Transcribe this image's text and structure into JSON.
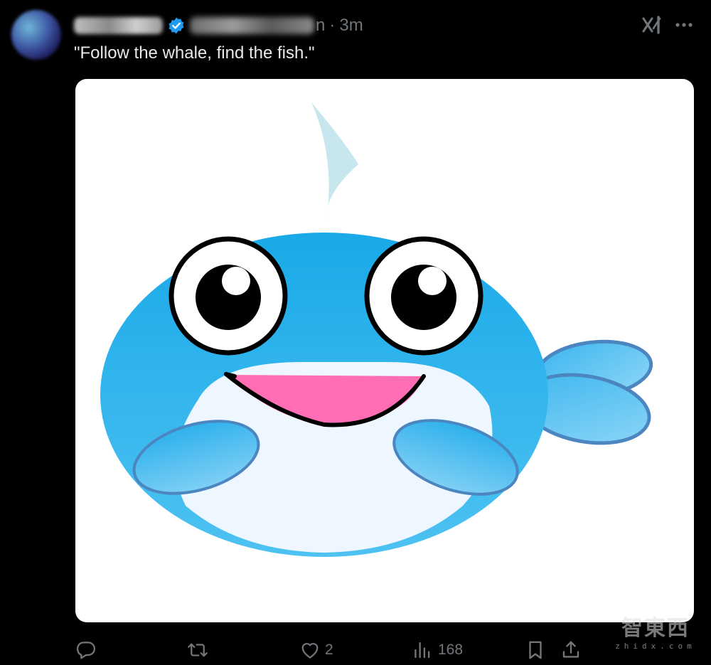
{
  "post": {
    "author_name": "",
    "handle_tail": "n",
    "separator": "·",
    "time": "3m",
    "text": "\"Follow the whale, find the fish.\""
  },
  "media": {
    "colors": {
      "body_blue": "#1ab0ec",
      "belly": "#eef7ff",
      "fin_blue": "#4eb8ee",
      "fin_outline": "#4b86c0",
      "mouth_pink": "#ff6eb4",
      "spout": "#c7e6ee",
      "eye_outline": "#000000"
    }
  },
  "actions": {
    "reply_icon": "reply-icon",
    "repost_icon": "repost-icon",
    "like_icon": "heart-icon",
    "like_count": "2",
    "views_icon": "views-icon",
    "view_count": "168",
    "bookmark_icon": "bookmark-icon",
    "share_icon": "share-icon"
  },
  "watermark": {
    "main": "智東西",
    "sub": "zhidx.com"
  },
  "header_icons": {
    "verified": "verified-badge-icon",
    "grok": "grok-icon",
    "more": "more-icon"
  }
}
